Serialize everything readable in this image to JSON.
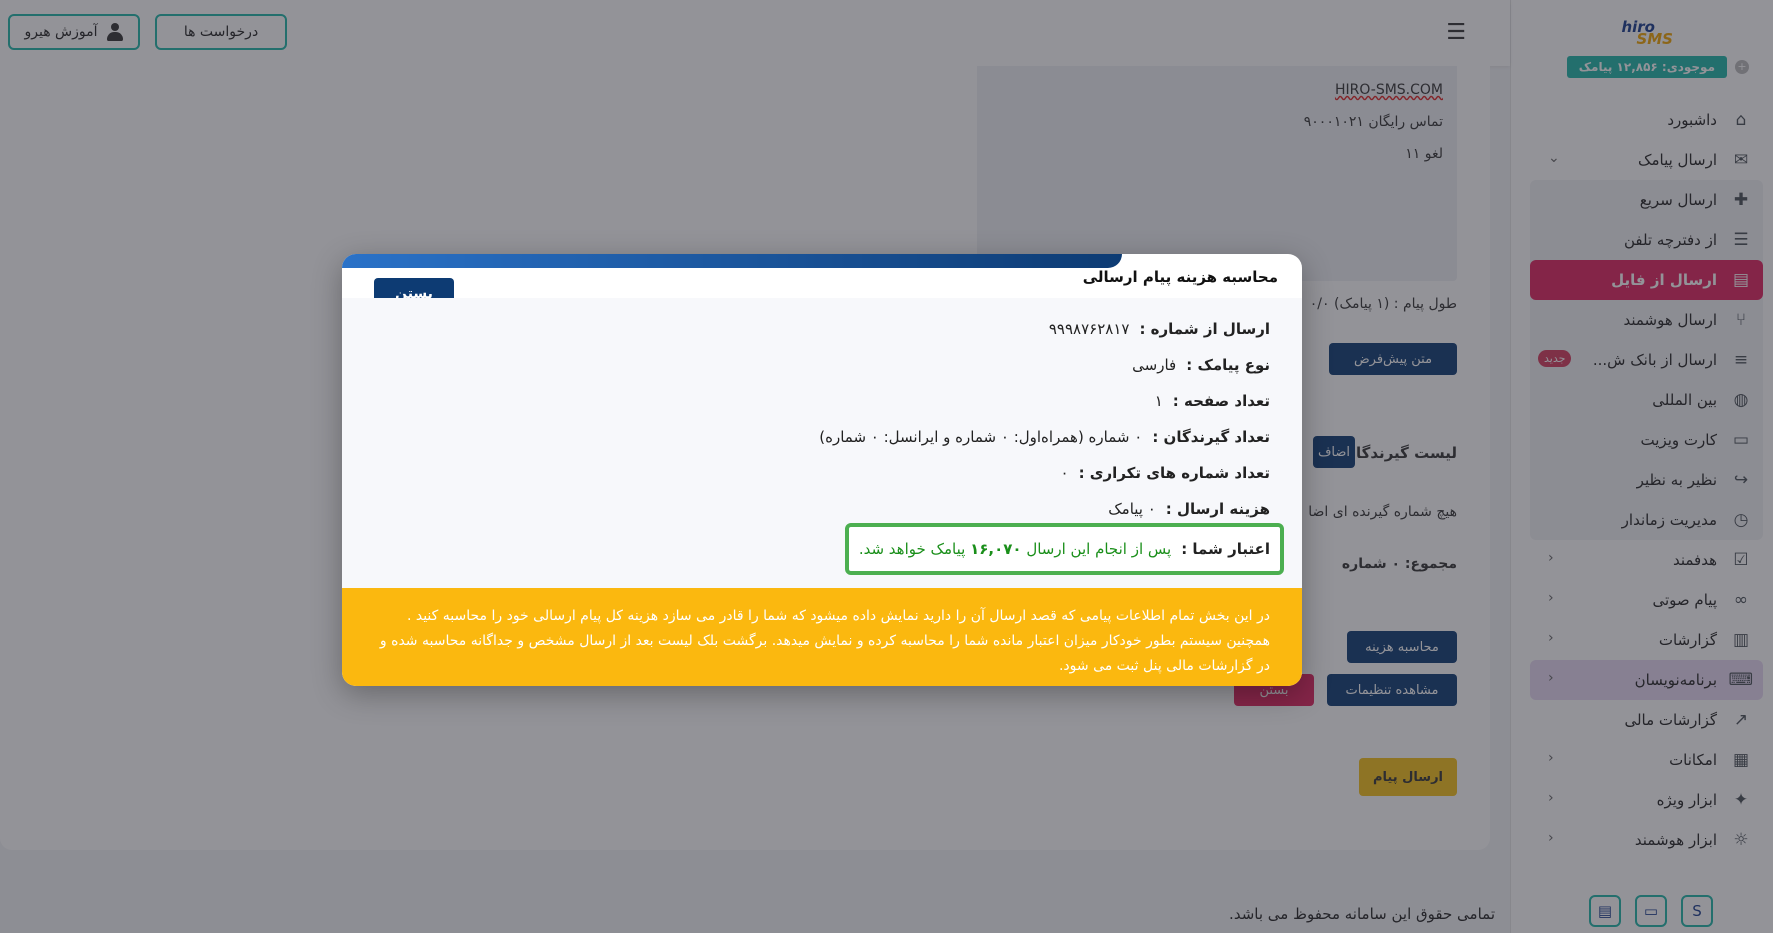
{
  "sidebar": {
    "logo": {
      "line1": "hiro",
      "line2": "SMS"
    },
    "balance": "موجودی: ۱۲,۸۵۶ پیامک",
    "menu": {
      "dashboard": "داشبورد",
      "send_sms": "ارسال پیامک",
      "quick_send": "ارسال سریع",
      "from_phonebook": "از دفترچه تلفن",
      "from_file": "ارسال از فایل",
      "smart_send": "ارسال هوشمند",
      "from_bank": "ارسال از بانک ش...",
      "new_badge": "جدید",
      "international": "بین المللی",
      "business_card": "کارت ویزیت",
      "peer_to_peer": "نظیر به نظیر",
      "scheduled": "مدیریت زماندار",
      "targeted": "هدفمند",
      "voice": "پیام صوتی",
      "reports": "گزارشات",
      "developers": "برنامه‌نویسان",
      "financial_reports": "گزارشات مالی",
      "features": "امکانات",
      "special_tools": "ابزار ویژه",
      "smart_tools": "ابزار هوشمند"
    },
    "bottom_btn_s": "S"
  },
  "topbar": {
    "requests": "درخواست ها",
    "training": "آموزش هیرو"
  },
  "preview": {
    "line1": "HIRO-SMS.COM",
    "line2": "تماس رایگان ۹۰۰۰۱۰۲۱",
    "line3": "لغو ۱۱"
  },
  "form": {
    "msg_length": "طول پیام : (۱ پیامک) ۰/۰",
    "default_text_btn": "متن پیش‌فرض",
    "recipients_label": "لیست گیرندگان:",
    "add_btn": "اضاف",
    "no_recipient": "هیچ شماره گیرنده ای اضا",
    "total": "مجموع: ۰ شماره",
    "calc_cost_btn": "محاسبه هزینه",
    "view_settings_btn": "مشاهده تنظیمات",
    "close_btn": "بستن",
    "send_btn": "ارسال پیام"
  },
  "modal": {
    "title": "محاسبه هزینه پیام ارسالی",
    "close": "بستن",
    "rows": [
      {
        "key": "ارسال از شماره :",
        "val": "۹۹۹۸۷۶۲۸۱۷"
      },
      {
        "key": "نوع پیامک :",
        "val": "فارسی"
      },
      {
        "key": "تعداد صفحه :",
        "val": "۱"
      },
      {
        "key": "تعداد گیرندگان :",
        "val": "۰ شماره (همراه‌اول: ۰ شماره و ایرانسل: ۰ شماره)"
      },
      {
        "key": "تعداد شماره های تکراری :",
        "val": "۰"
      },
      {
        "key": "هزینه ارسال :",
        "val": "۰  پیامک"
      }
    ],
    "credit_key": "اعتبار شما :",
    "credit_pre": "پس از انجام این ارسال",
    "credit_amount": "۱۶,۰۷۰",
    "credit_post": "پیامک خواهد شد.",
    "note": "در این بخش تمام اطلاعات پیامی که قصد ارسال آن را دارید نمایش داده میشود که شما را قادر می سازد هزینه کل پیام ارسالی خود را محاسبه کنید . همچنین سیستم بطور خودکار میزان اعتبار مانده شما را محاسبه کرده و نمایش میدهد. برگشت بلک لیست بعد از ارسال مشخص و جداگانه محاسبه شده و در گزارشات مالی پنل ثبت می شود."
  },
  "footer": "تمامی حقوق این سامانه محفوظ می باشد."
}
